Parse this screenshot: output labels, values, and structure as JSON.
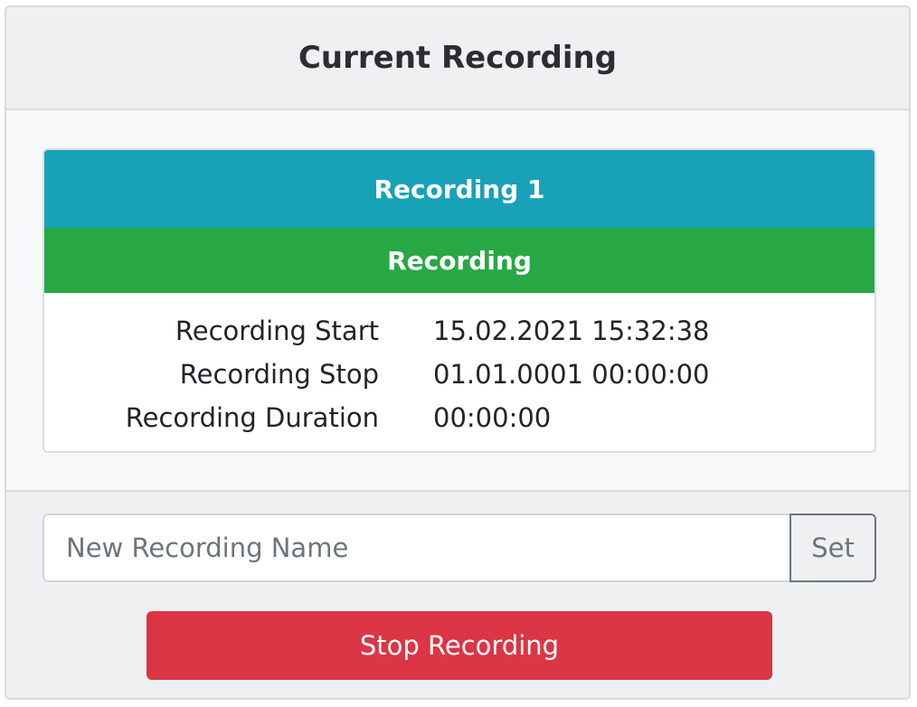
{
  "header": {
    "title": "Current Recording"
  },
  "recording": {
    "name": "Recording 1",
    "status": "Recording",
    "fields": [
      {
        "label": "Recording Start",
        "value": "15.02.2021 15:32:38"
      },
      {
        "label": "Recording Stop",
        "value": "01.01.0001 00:00:00"
      },
      {
        "label": "Recording Duration",
        "value": "00:00:00"
      }
    ]
  },
  "rename": {
    "placeholder": "New Recording Name",
    "value": "",
    "set_label": "Set"
  },
  "actions": {
    "stop_label": "Stop Recording"
  },
  "colors": {
    "name_banner": "#17a2b8",
    "status_banner": "#28a745",
    "stop_button": "#dc3545",
    "set_button_border": "#6c757d"
  }
}
